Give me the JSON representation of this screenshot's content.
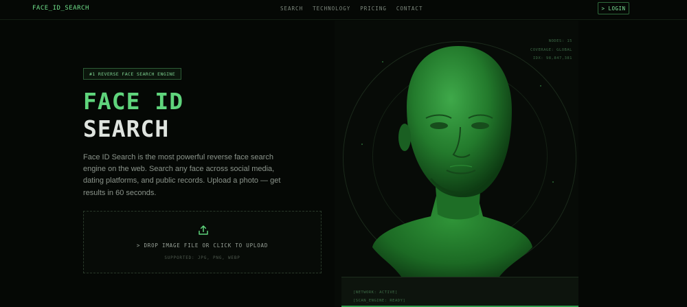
{
  "nav": {
    "logo": "FACE_ID_SEARCH",
    "links": [
      "SEARCH",
      "TECHNOLOGY",
      "PRICING",
      "CONTACT"
    ],
    "login": "> LOGIN"
  },
  "hero": {
    "badge": "#1 REVERSE FACE SEARCH ENGINE",
    "title_line1": "FACE ID",
    "title_line2": "SEARCH",
    "description": "Face ID Search is the most powerful reverse face search engine on the web. Search any face across social media, dating platforms, and public records. Upload a photo — get results in 60 seconds."
  },
  "upload": {
    "prompt": "> DROP IMAGE FILE OR CLICK TO UPLOAD",
    "supported": "SUPPORTED: JPG, PNG, WEBP",
    "icon": "upload-icon"
  },
  "visual": {
    "stats": [
      "NODES: 15",
      "COVERAGE: GLOBAL",
      "IDX: 98,847,381"
    ],
    "console": [
      "[NETWORK: ACTIVE]",
      "[SCAN_ENGINE: READY]"
    ]
  },
  "colors": {
    "accent": "#5fd47c",
    "background": "#050805",
    "muted": "#8b948b"
  }
}
